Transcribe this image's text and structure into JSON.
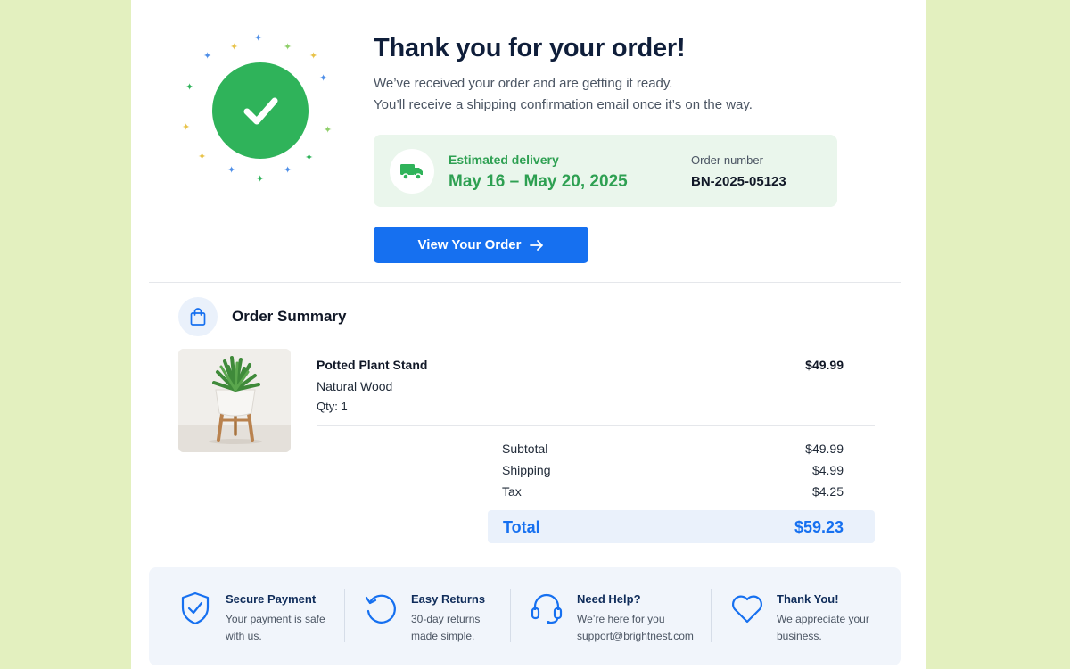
{
  "hero": {
    "title": "Thank you for your order!",
    "subtitle_line1": "We’ve received your order and are getting it ready.",
    "subtitle_line2": "You’ll receive a shipping confirmation email once it’s on the way."
  },
  "delivery": {
    "eta_label": "Estimated delivery",
    "eta_value": "May 16 – May 20, 2025",
    "order_label": "Order number",
    "order_value": "BN-2025-05123"
  },
  "cta": {
    "label": "View Your Order"
  },
  "summary": {
    "title": "Order Summary",
    "item": {
      "name": "Potted Plant Stand",
      "variant": "Natural Wood",
      "qty": "Qty: 1",
      "price": "$49.99"
    },
    "rows": [
      {
        "label": "Subtotal",
        "value": "$49.99"
      },
      {
        "label": "Shipping",
        "value": "$4.99"
      },
      {
        "label": "Tax",
        "value": "$4.25"
      }
    ],
    "total_label": "Total",
    "total_value": "$59.23"
  },
  "features": [
    {
      "icon": "shield-check-icon",
      "title": "Secure Payment",
      "line1": "Your payment is safe",
      "line2": "with us."
    },
    {
      "icon": "refresh-icon",
      "title": "Easy Returns",
      "line1": "30-day returns",
      "line2": "made simple."
    },
    {
      "icon": "headset-icon",
      "title": "Need Help?",
      "line1": "We’re here for you",
      "line2": "support@brightnest.com"
    },
    {
      "icon": "heart-icon",
      "title": "Thank You!",
      "line1": "We appreciate your",
      "line2": "business."
    }
  ],
  "colors": {
    "background": "#e3f0bf",
    "success": "#2fb35a",
    "accent": "#1670f0",
    "navy": "#0f1e3a"
  }
}
